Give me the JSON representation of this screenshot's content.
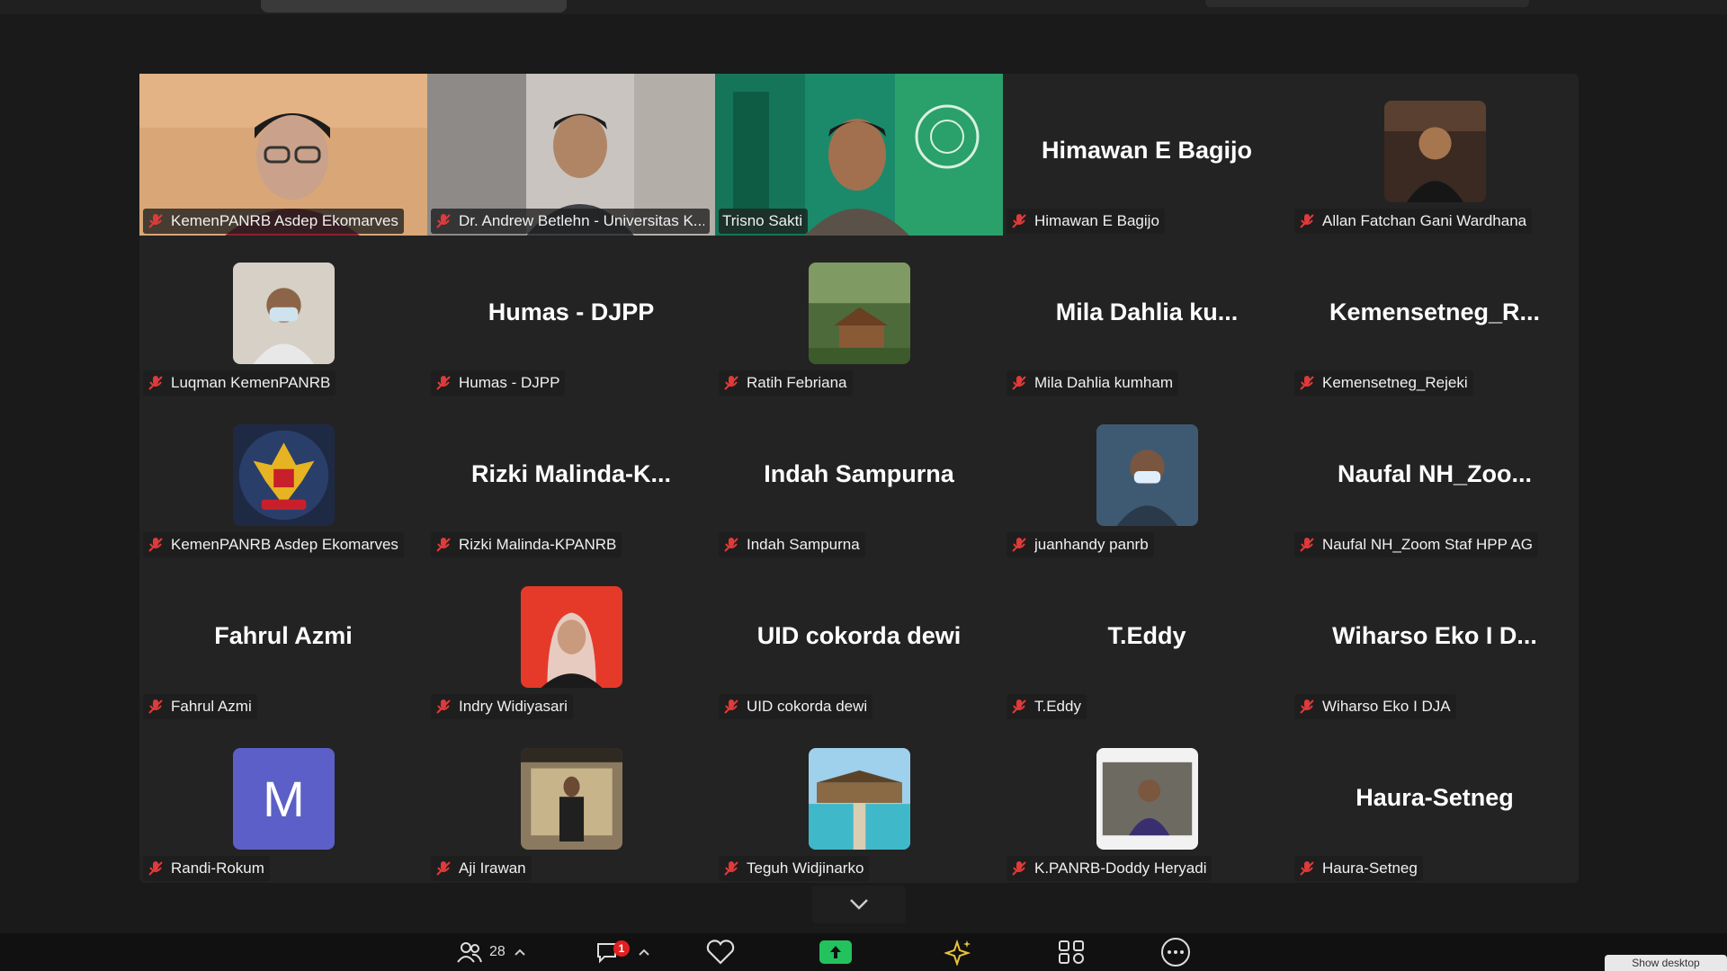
{
  "participants_count": "28",
  "chat_badge": "1",
  "show_desktop_label": "Show desktop",
  "tiles": [
    {
      "name": "KemenPANRB Asdep Ekomarves",
      "type": "video"
    },
    {
      "name": "Dr. Andrew Betlehn - Universitas K...",
      "type": "video"
    },
    {
      "name": "Trisno Sakti",
      "type": "video",
      "active": true
    },
    {
      "name": "Himawan E Bagijo",
      "display": "Himawan E Bagijo",
      "type": "name"
    },
    {
      "name": "Allan Fatchan Gani Wardhana",
      "type": "avatar"
    },
    {
      "name": "Luqman KemenPANRB",
      "type": "avatar"
    },
    {
      "name": "Humas - DJPP",
      "display": "Humas - DJPP",
      "type": "name"
    },
    {
      "name": "Ratih Febriana",
      "type": "avatar"
    },
    {
      "name": "Mila Dahlia kumham",
      "display": "Mila Dahlia ku...",
      "type": "name"
    },
    {
      "name": "Kemensetneg_Rejeki",
      "display": "Kemensetneg_R...",
      "type": "name"
    },
    {
      "name": "KemenPANRB Asdep Ekomarves",
      "type": "avatar"
    },
    {
      "name": "Rizki Malinda-KPANRB",
      "display": "Rizki  Malinda-K...",
      "type": "name"
    },
    {
      "name": "Indah Sampurna",
      "display": "Indah Sampurna",
      "type": "name"
    },
    {
      "name": "juanhandy panrb",
      "type": "avatar"
    },
    {
      "name": "Naufal NH_Zoom Staf HPP AG",
      "display": "Naufal NH_Zoo...",
      "type": "name"
    },
    {
      "name": "Fahrul Azmi",
      "display": "Fahrul Azmi",
      "type": "name"
    },
    {
      "name": "Indry Widiyasari",
      "type": "avatar"
    },
    {
      "name": "UID cokorda dewi",
      "display": "UID cokorda dewi",
      "type": "name"
    },
    {
      "name": "T.Eddy",
      "display": "T.Eddy",
      "type": "name"
    },
    {
      "name": "Wiharso Eko I DJA",
      "display": "Wiharso Eko I D...",
      "type": "name"
    },
    {
      "name": "Randi-Rokum",
      "type": "avatar",
      "letter": "M"
    },
    {
      "name": "Aji Irawan",
      "type": "avatar"
    },
    {
      "name": "Teguh Widjinarko",
      "type": "avatar"
    },
    {
      "name": "K.PANRB-Doddy Heryadi",
      "type": "avatar"
    },
    {
      "name": "Haura-Setneg",
      "display": "Haura-Setneg",
      "type": "name"
    }
  ],
  "colors": {
    "active_speaker": "#23d160",
    "muted_icon": "#e03a3a",
    "share_button": "#23c25c",
    "letter_avatar": "#5b5fc7"
  }
}
